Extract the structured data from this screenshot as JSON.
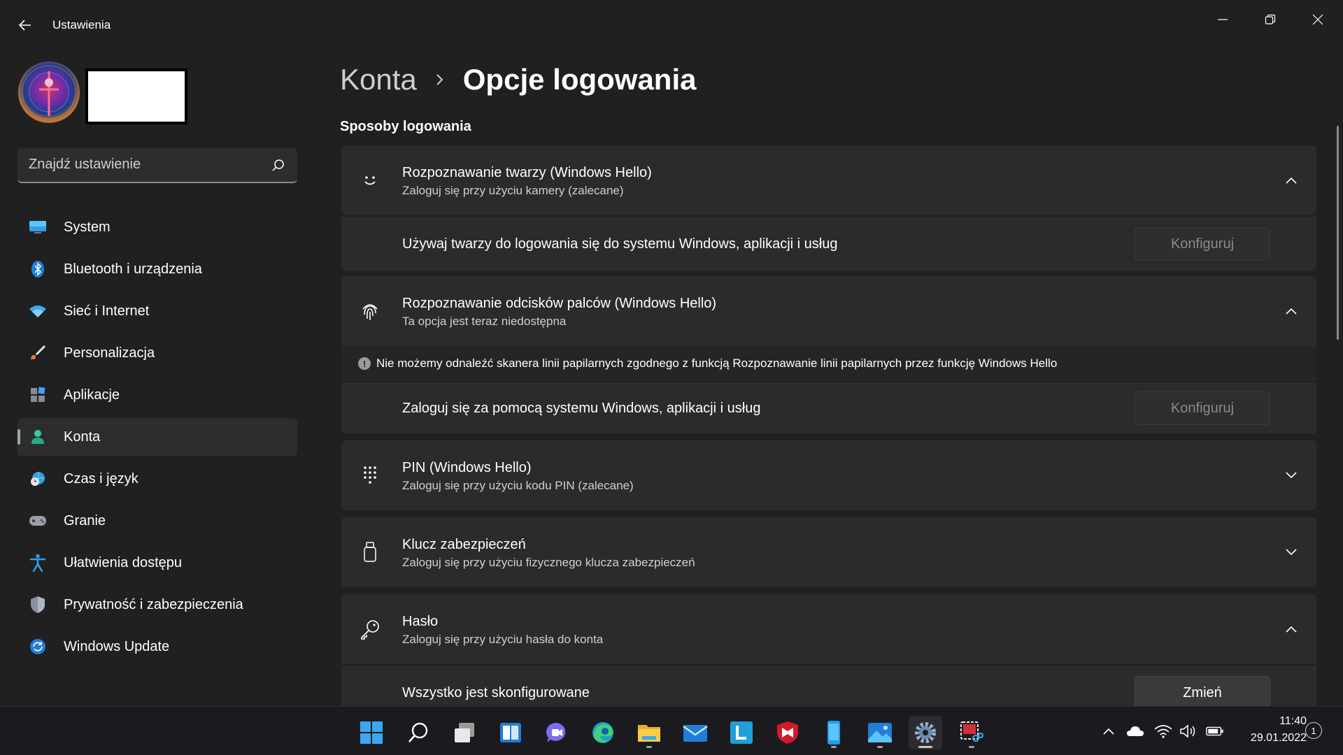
{
  "window": {
    "title": "Ustawienia",
    "controls": [
      "minimize-icon",
      "restore-icon",
      "close-icon"
    ]
  },
  "sidebar": {
    "search_placeholder": "Znajdź ustawienie",
    "items": [
      {
        "label": "System",
        "icon": "monitor-icon",
        "active": false
      },
      {
        "label": "Bluetooth i urządzenia",
        "icon": "bluetooth-icon",
        "active": false
      },
      {
        "label": "Sieć i Internet",
        "icon": "wifi-icon",
        "active": false
      },
      {
        "label": "Personalizacja",
        "icon": "brush-icon",
        "active": false
      },
      {
        "label": "Aplikacje",
        "icon": "apps-icon",
        "active": false
      },
      {
        "label": "Konta",
        "icon": "account-icon",
        "active": true
      },
      {
        "label": "Czas i język",
        "icon": "globe-clock-icon",
        "active": false
      },
      {
        "label": "Granie",
        "icon": "gamepad-icon",
        "active": false
      },
      {
        "label": "Ułatwienia dostępu",
        "icon": "accessibility-icon",
        "active": false
      },
      {
        "label": "Prywatność i zabezpieczenia",
        "icon": "shield-icon",
        "active": false
      },
      {
        "label": "Windows Update",
        "icon": "update-icon",
        "active": false
      }
    ]
  },
  "main": {
    "breadcrumb_parent": "Konta",
    "breadcrumb_current": "Opcje logowania",
    "section_title": "Sposoby logowania",
    "face": {
      "title": "Rozpoznawanie twarzy (Windows Hello)",
      "subtitle": "Zaloguj się przy użyciu kamery (zalecane)",
      "row_text": "Używaj twarzy do logowania się do systemu Windows, aplikacji i usług",
      "button": "Konfiguruj"
    },
    "fingerprint": {
      "title": "Rozpoznawanie odcisków palców (Windows Hello)",
      "subtitle": "Ta opcja jest teraz niedostępna",
      "info": "Nie możemy odnaleźć skanera linii papilarnych zgodnego z funkcją Rozpoznawanie linii papilarnych przez funkcję Windows Hello",
      "row_text": "Zaloguj się za pomocą systemu Windows, aplikacji i usług",
      "button": "Konfiguruj"
    },
    "pin": {
      "title": "PIN (Windows Hello)",
      "subtitle": "Zaloguj się przy użyciu kodu PIN (zalecane)"
    },
    "key": {
      "title": "Klucz zabezpieczeń",
      "subtitle": "Zaloguj się przy użyciu fizycznego klucza zabezpieczeń"
    },
    "password": {
      "title": "Hasło",
      "subtitle": "Zaloguj się przy użyciu hasła do konta",
      "row_text": "Wszystko jest skonfigurowane",
      "button": "Zmień"
    }
  },
  "taskbar": {
    "apps": [
      "start-icon",
      "search-icon",
      "task-view-icon",
      "widgets-icon",
      "teams-chat-icon",
      "edge-icon",
      "file-explorer-icon",
      "mail-icon",
      "l-app-icon",
      "mcafee-icon",
      "phone-app-icon",
      "photos-icon",
      "settings-icon",
      "snipping-tool-icon"
    ],
    "time": "11:40",
    "date": "29.01.2022",
    "notifications": "1"
  },
  "colors": {
    "background": "#202020",
    "card": "#2b2b2b",
    "accent": "#4cc2ff"
  }
}
